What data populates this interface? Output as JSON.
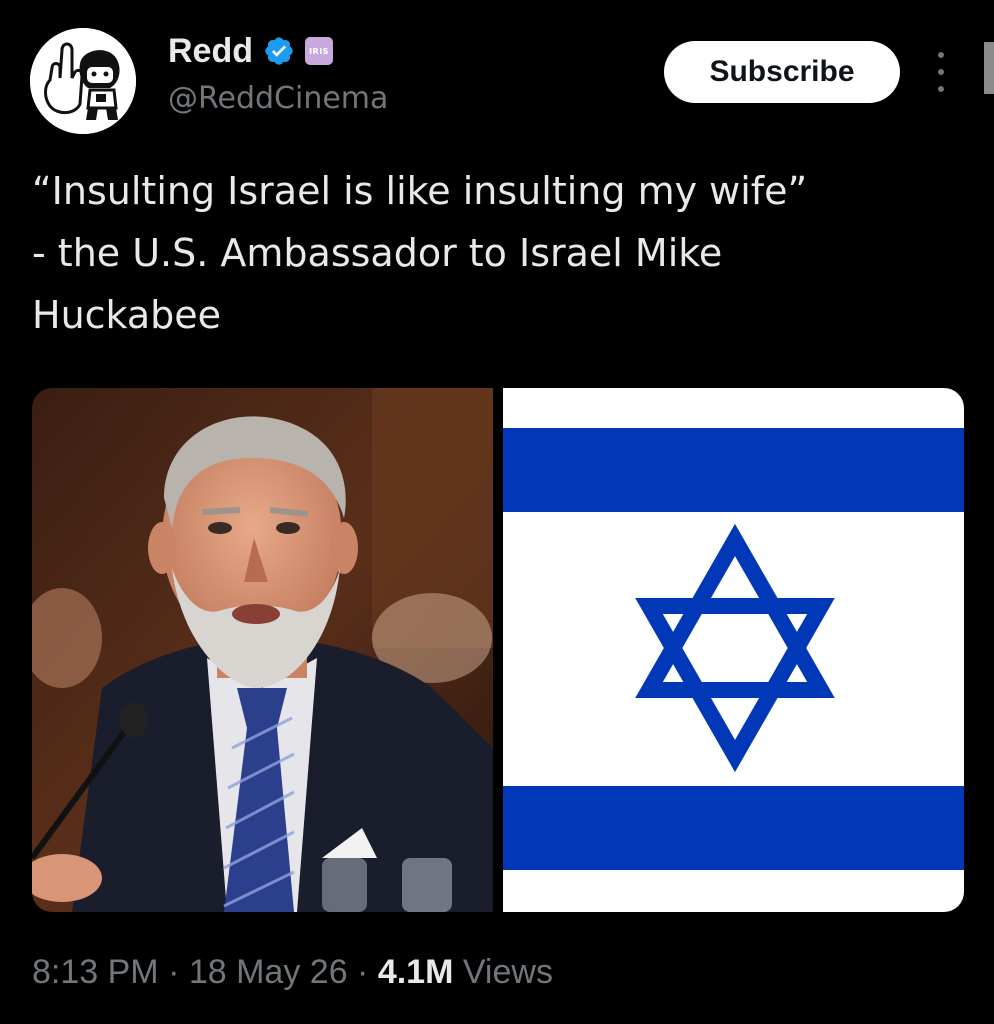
{
  "author": {
    "display_name": "Redd",
    "handle": "@ReddCinema",
    "affiliate_badge_text": "IRIS",
    "verified_color": "#1d9bf0"
  },
  "subscribe_label": "Subscribe",
  "tweet": {
    "text": "“Insulting Israel is like insulting my wife”\n- the U.S. Ambassador to Israel Mike\nHuckabee"
  },
  "media": {
    "flag_blue": "#0038b8",
    "flag_white": "#ffffff"
  },
  "meta": {
    "time": "8:13 PM",
    "separator": " · ",
    "date": "18 May 26",
    "views_count": "4.1M",
    "views_label": " Views"
  },
  "colors": {
    "background": "#000000",
    "text_primary": "#e7e9ea",
    "text_secondary": "#71767b"
  }
}
